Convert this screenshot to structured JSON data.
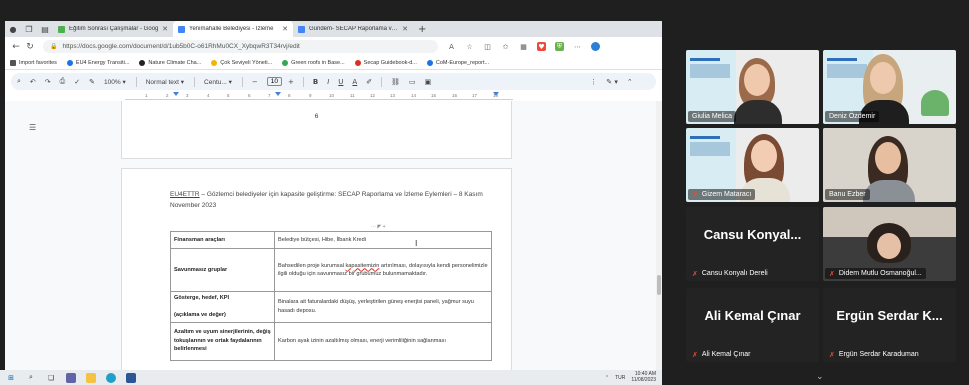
{
  "browser": {
    "tabs": [
      {
        "label": "Eğitim Sonrası Çalışmalar - Goog",
        "color": "#4caf50",
        "active": false
      },
      {
        "label": "Yenimahalle Belediyesi - İzleme",
        "color": "#4285f4",
        "active": true
      },
      {
        "label": "Gündem- SECAP Raporlama ve İz",
        "color": "#4285f4",
        "active": false
      }
    ],
    "url": "https://docs.google.com/document/d/1ub5b0C-o61RhMu0CX_XybqwR3T34rvj/edit",
    "bookmarks": [
      {
        "label": "Import favorites",
        "color": "#555555"
      },
      {
        "label": "EU4 Energy Transiti...",
        "color": "#1a73e8"
      },
      {
        "label": "Nature Climate Cha...",
        "color": "#222222"
      },
      {
        "label": "Çok Seviyeli Yöneti...",
        "color": "#f4b400"
      },
      {
        "label": "Green roofs in Base...",
        "color": "#34a853"
      },
      {
        "label": "Secap Guidebook-d...",
        "color": "#d93025"
      },
      {
        "label": "CoM-Europe_report...",
        "color": "#1a73e8"
      }
    ]
  },
  "toolbar": {
    "zoom": "100%",
    "style": "Normal text",
    "font": "Centu...",
    "size": "10",
    "bold": "B",
    "italic": "I",
    "underline": "U",
    "color": "A"
  },
  "ruler": [
    "1",
    "2",
    "3",
    "4",
    "5",
    "6",
    "7",
    "8",
    "9",
    "10",
    "11",
    "12",
    "13",
    "14",
    "15",
    "16",
    "17",
    "18"
  ],
  "document": {
    "prev_page_number": "6",
    "title_link": "EU4ETTR",
    "title_rest": " – Gözlemci belediyeler için kapasite geliştirme: SECAP Raporlama ve İzleme Eylemleri – 8 Kasım November 2023",
    "table": [
      {
        "key": "Finansman araçları",
        "value": "Belediye bütçesi, Hibe, İlbank Kredi"
      },
      {
        "key": "Savunmasız gruplar",
        "value_before": "Bahsedilen proje kurumsal ",
        "value_squiggle": "kapasitemizin",
        "value_after": " artırılması, dolayısıyla kendi personelimizle ilgili olduğu için savunmasız bir grubumuz bulunmamaktadır."
      },
      {
        "key": "Gösterge, hedef, KPI",
        "key2": "(açıklama ve değer)",
        "value": "Binalara ait faturalardaki düşüş, yerleştirilen güneş enerjisi paneli, yağmur suyu hasadı deposu."
      },
      {
        "key": "Azaltım ve uyum sinerjilerinin, değiş tokuşlarının ve ortak faydalarının belirlenmesi",
        "value": "Karbon ayak izinin azaltılmış olması, enerji verimliliğinin sağlanması"
      }
    ]
  },
  "taskbar": {
    "lang": "TUR",
    "time": "10:40 AM",
    "date": "11/08/2023"
  },
  "participants": [
    {
      "name": "Giulia Melica",
      "type": "video",
      "muted": false
    },
    {
      "name": "Deniz Özdemir",
      "type": "video",
      "muted": false
    },
    {
      "name": "Gizem Mataracı",
      "type": "video",
      "muted": true
    },
    {
      "name": "Banu Ezber",
      "type": "video",
      "muted": false,
      "speaking": true
    },
    {
      "name": "Cansu Konyalı Dereli",
      "display": "Cansu Konyal...",
      "type": "name",
      "muted": true
    },
    {
      "name": "Didem Mutlu Osmanoğul...",
      "type": "video",
      "muted": true
    },
    {
      "name": "Ali Kemal Çınar",
      "display": "Ali Kemal Çınar",
      "type": "name",
      "muted": true
    },
    {
      "name": "Ergün Serdar Karaduman",
      "display": "Ergün Serdar K...",
      "type": "name",
      "muted": true
    }
  ]
}
